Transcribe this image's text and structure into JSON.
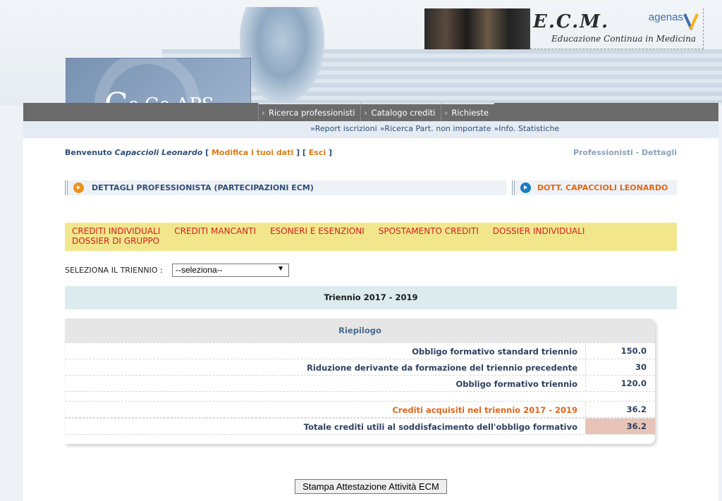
{
  "header": {
    "ecm_title": "E.C.M.",
    "ecm_subtitle": "Educazione Continua in Medicina",
    "agenas": "agenas",
    "logo_big": "C",
    "logo_rest": "o.Ge.APS"
  },
  "nav": {
    "items": [
      {
        "label": "Ricerca professionisti"
      },
      {
        "label": "Catalogo crediti"
      },
      {
        "label": "Richieste"
      }
    ],
    "sub_items": [
      {
        "label": "»Report iscrizioni"
      },
      {
        "label": "»Ricerca Part. non importate"
      },
      {
        "label": "»Info. Statistiche"
      }
    ]
  },
  "welcome": {
    "prefix": "Benvenuto ",
    "name": "Capaccioli Leonardo",
    "bracket_open_1": " [ ",
    "edit_link": "Modifica i tuoi dati",
    "bracket_mid": " ] [ ",
    "exit_link": "Esci",
    "bracket_close": " ]"
  },
  "breadcrumb": "Professionisti - Dettagli",
  "section": {
    "title": "DETTAGLI PROFESSIONISTA (PARTECIPAZIONI ECM)",
    "professional": "DOTT. CAPACCIOLI LEONARDO"
  },
  "tabs": [
    {
      "label": "CREDITI INDIVIDUALI"
    },
    {
      "label": "CREDITI MANCANTI"
    },
    {
      "label": "ESONERI E ESENZIONI"
    },
    {
      "label": "SPOSTAMENTO CREDITI"
    },
    {
      "label": "DOSSIER INDIVIDUALI"
    },
    {
      "label": "DOSSIER DI GRUPPO"
    }
  ],
  "triennio": {
    "label": "SELEZIONA IL TRIENNIO :",
    "selected": "--seleziona--",
    "title": "Triennio 2017 - 2019"
  },
  "summary": {
    "heading": "Riepilogo",
    "rows": [
      {
        "label": "Obbligo formativo standard triennio",
        "value": "150.0"
      },
      {
        "label": "Riduzione derivante da formazione del triennio precedente",
        "value": "30"
      },
      {
        "label": "Obbligo formativo triennio",
        "value": "120.0"
      },
      {
        "label": "Crediti acquisiti nel triennio 2017 - 2019",
        "value": "36.2"
      },
      {
        "label": "Totale crediti utili al soddisfacimento dell'obbligo formativo",
        "value": "36.2"
      }
    ]
  },
  "print_button": "Stampa Attestazione Attività ECM",
  "colors": {
    "accent_orange": "#e0661a",
    "tab_red": "#d1221c",
    "tab_bg": "#f2e68c",
    "nav_grey": "#6b6b6b",
    "total_highlight": "#e8c3b8"
  }
}
